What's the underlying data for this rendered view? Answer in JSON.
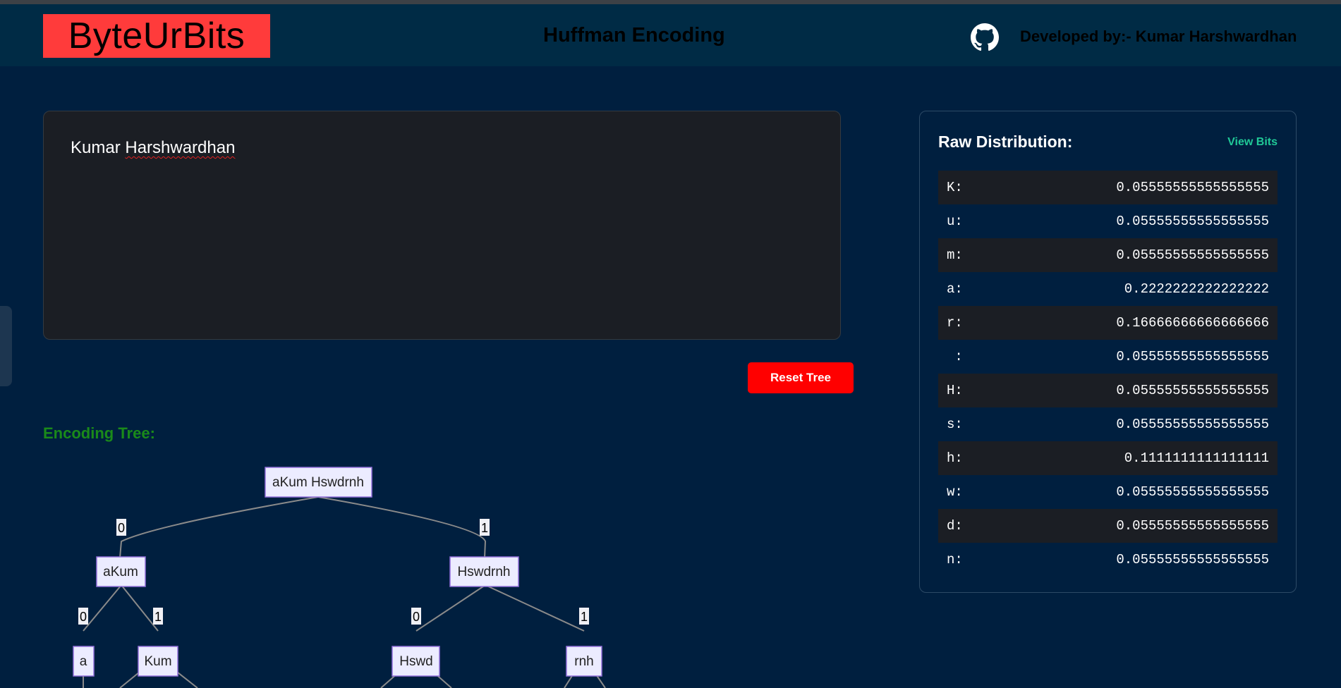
{
  "header": {
    "logo": "ByteUrBits",
    "title": "Huffman Encoding",
    "developer": "Developed by:- Kumar Harshwardhan"
  },
  "input": {
    "value_part1": "Kumar ",
    "value_part2": "Harshwardhan"
  },
  "actions": {
    "reset_label": "Reset Tree"
  },
  "tree": {
    "title": "Encoding Tree:",
    "nodes": {
      "root": "aKum Hswdrnh",
      "left": "aKum",
      "right": "Hswdrnh",
      "left_left": "a",
      "left_right": "Kum",
      "right_left": "Hswd",
      "right_right": "rnh"
    },
    "edge_labels": {
      "root_left": "0",
      "root_right": "1",
      "left_left": "0",
      "left_right": "1",
      "right_left": "0",
      "right_right": "1"
    }
  },
  "distribution": {
    "title": "Raw Distribution:",
    "view_bits_label": "View Bits",
    "rows": [
      {
        "char": "K:",
        "prob": "0.05555555555555555"
      },
      {
        "char": "u:",
        "prob": "0.05555555555555555"
      },
      {
        "char": "m:",
        "prob": "0.05555555555555555"
      },
      {
        "char": "a:",
        "prob": "0.2222222222222222"
      },
      {
        "char": "r:",
        "prob": "0.16666666666666666"
      },
      {
        "char": " :",
        "prob": "0.05555555555555555"
      },
      {
        "char": "H:",
        "prob": "0.05555555555555555"
      },
      {
        "char": "s:",
        "prob": "0.05555555555555555"
      },
      {
        "char": "h:",
        "prob": "0.1111111111111111"
      },
      {
        "char": "w:",
        "prob": "0.05555555555555555"
      },
      {
        "char": "d:",
        "prob": "0.05555555555555555"
      },
      {
        "char": "n:",
        "prob": "0.05555555555555555"
      }
    ]
  },
  "colors": {
    "background": "#001f3f",
    "header": "#002b45",
    "logo_bg": "#ff3b3b",
    "accent": "#20c997",
    "reset": "#ff0000",
    "tree_title": "#1a8a1a"
  },
  "icons": {
    "github": "github-icon"
  }
}
